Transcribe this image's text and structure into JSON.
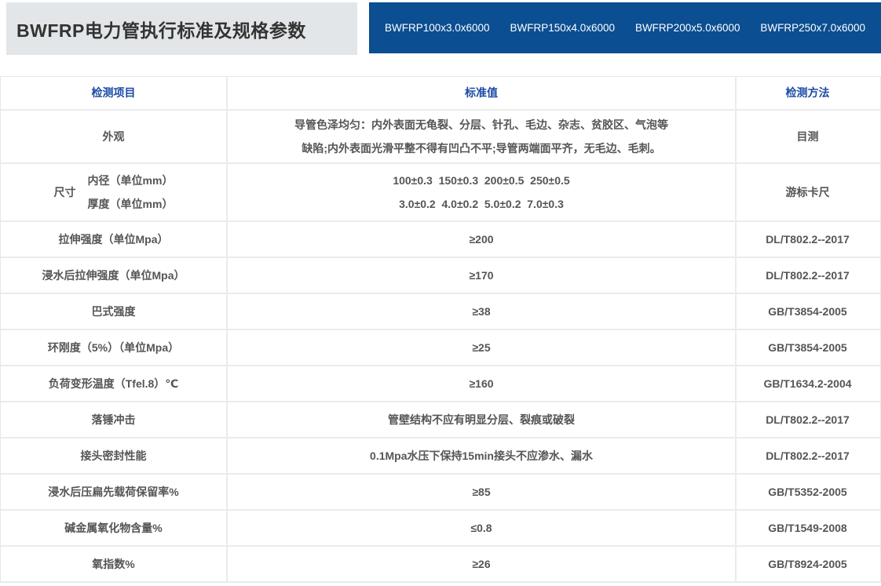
{
  "header": {
    "title": "BWFRP电力管执行标准及规格参数",
    "products": [
      "BWFRP100x3.0x6000",
      "BWFRP150x4.0x6000",
      "BWFRP200x5.0x6000",
      "BWFRP250x7.0x6000"
    ]
  },
  "colors": {
    "brand_blue": "#0b4e92",
    "title_box_gray": "#e3e6e8",
    "header_text_blue": "#1a4aa5",
    "body_text": "#555555",
    "border_gray": "#ebebeb"
  },
  "table": {
    "columns": {
      "item": "检测项目",
      "value": "标准值",
      "method": "检测方法"
    },
    "appearance_row": {
      "item": "外观",
      "value_line1": "导管色泽均匀：内外表面无龟裂、分层、针孔、毛边、杂志、贫胶区、气泡等",
      "value_line2": "缺陷;内外表面光滑平整不得有凹凸不平;导管两端面平齐，无毛边、毛刺。",
      "method": "目测"
    },
    "size_row": {
      "item": "尺寸",
      "sub_item1": "内径（单位mm）",
      "sub_item2": "厚度（单位mm）",
      "value_line1": "100±0.3  150±0.3  200±0.5  250±0.5",
      "value_line2": "3.0±0.2  4.0±0.2  5.0±0.2  7.0±0.3",
      "method": "游标卡尺"
    },
    "rows": [
      {
        "item": "拉伸强度（单位Mpa）",
        "value": "≥200",
        "method": "DL/T802.2--2017"
      },
      {
        "item": "浸水后拉伸强度（单位Mpa）",
        "value": "≥170",
        "method": "DL/T802.2--2017"
      },
      {
        "item": "巴式强度",
        "value": "≥38",
        "method": "GB/T3854-2005"
      },
      {
        "item": "环刚度（5%）（单位Mpa）",
        "value": "≥25",
        "method": "GB/T3854-2005"
      },
      {
        "item": "负荷变形温度（Tfel.8）℃",
        "value": "≥160",
        "method": "GB/T1634.2-2004"
      },
      {
        "item": "落锤冲击",
        "value": "管壁结构不应有明显分层、裂痕或破裂",
        "method": "DL/T802.2--2017"
      },
      {
        "item": "接头密封性能",
        "value": "0.1Mpa水压下保持15min接头不应渗水、漏水",
        "method": "DL/T802.2--2017"
      },
      {
        "item": "浸水后压扁先载荷保留率%",
        "value": "≥85",
        "method": "GB/T5352-2005"
      },
      {
        "item": "碱金属氧化物含量%",
        "value": "≤0.8",
        "method": "GB/T1549-2008"
      },
      {
        "item": "氧指数%",
        "value": "≥26",
        "method": "GB/T8924-2005"
      }
    ]
  }
}
